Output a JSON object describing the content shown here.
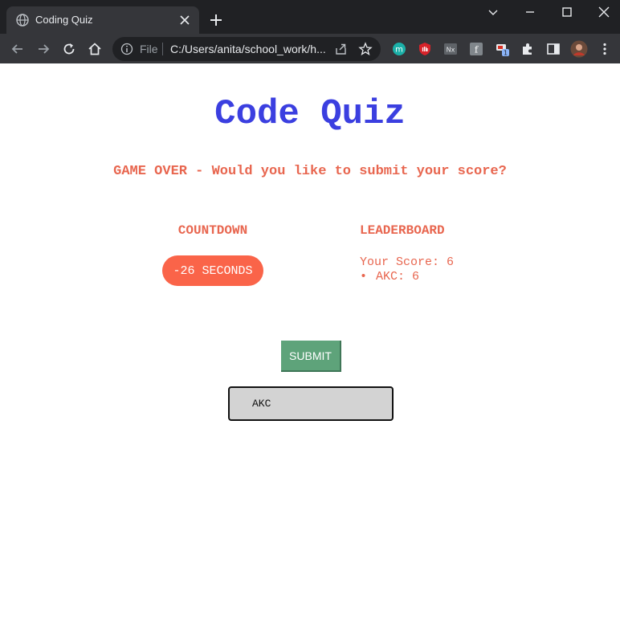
{
  "browser": {
    "tab_title": "Coding Quiz",
    "omnibox": {
      "scheme_label": "File",
      "url": "C:/Users/anita/school_work/h..."
    },
    "extension_badge": "1",
    "icons": [
      "globe-icon",
      "close-icon",
      "plus-icon",
      "chevron-down-icon",
      "minimize-icon",
      "maximize-icon",
      "window-close-icon",
      "back-arrow-icon",
      "forward-arrow-icon",
      "reload-icon",
      "home-icon",
      "info-icon",
      "share-icon",
      "star-icon",
      "extensions-puzzle-icon",
      "side-panel-icon",
      "profile-avatar",
      "more-menu-icon"
    ]
  },
  "page": {
    "title": "Code Quiz",
    "status_message": "GAME OVER - Would you like to submit your score?",
    "countdown": {
      "heading": "COUNTDOWN",
      "value": "-26 SECONDS"
    },
    "leaderboard": {
      "heading": "LEADERBOARD",
      "your_score": "Your Score: 6",
      "entries": [
        {
          "text": "AKC: 6"
        }
      ]
    },
    "submit_label": "SUBMIT",
    "initials_input_value": "AKC"
  },
  "colors": {
    "title": "#3b3fe0",
    "accent": "#e8664f",
    "countdown_pill": "#fa6449",
    "submit_button": "#5ea37a",
    "input_bg": "#d3d3d3"
  }
}
